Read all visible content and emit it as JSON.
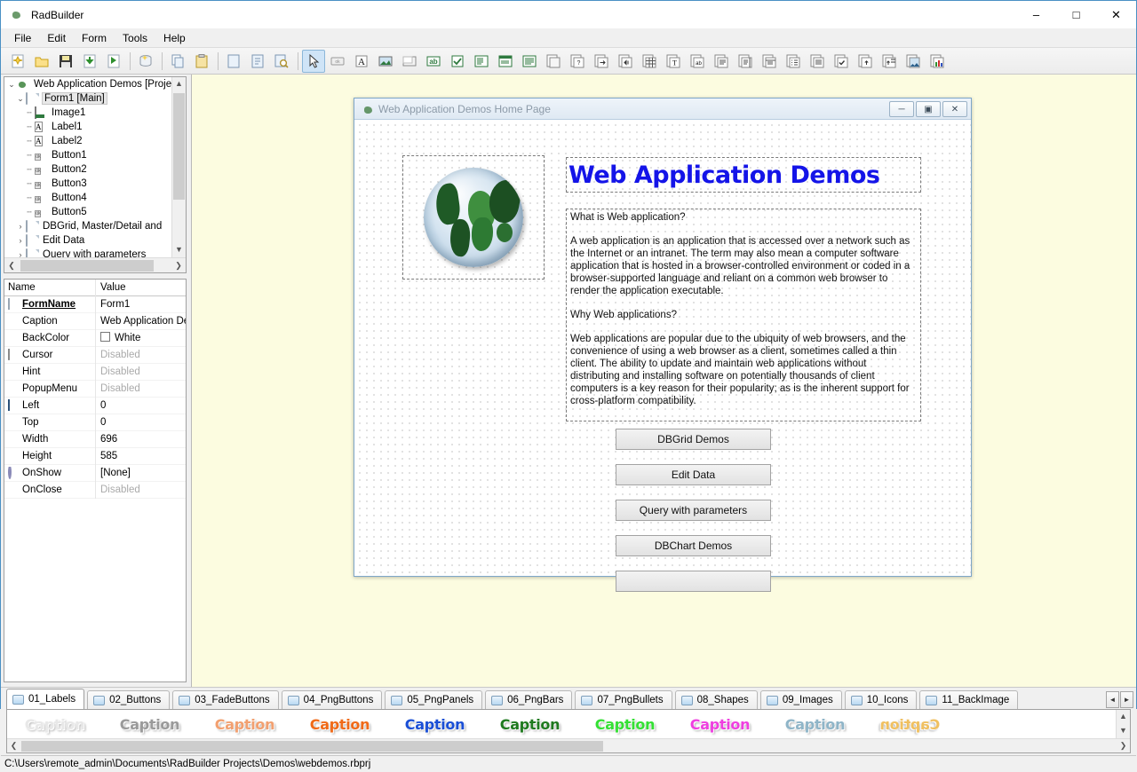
{
  "window": {
    "title": "RadBuilder",
    "app_icon": "globe-icon",
    "controls": {
      "minimize": "–",
      "maximize": "□",
      "close": "✕"
    }
  },
  "menu": {
    "items": [
      "File",
      "Edit",
      "Form",
      "Tools",
      "Help"
    ]
  },
  "toolbar": {
    "groups": [
      {
        "buttons": [
          {
            "name": "new-project-icon",
            "glyph": "✶"
          },
          {
            "name": "open-project-icon",
            "glyph": "📂"
          },
          {
            "name": "save-icon",
            "glyph": "💾"
          },
          {
            "name": "import-icon",
            "glyph": "⬇"
          },
          {
            "name": "run-icon",
            "glyph": "▶"
          }
        ]
      },
      {
        "buttons": [
          {
            "name": "database-icon",
            "glyph": "🗄"
          }
        ]
      },
      {
        "buttons": [
          {
            "name": "copy-icon",
            "glyph": "⧉"
          },
          {
            "name": "paste-icon",
            "glyph": "📋"
          }
        ]
      },
      {
        "buttons": [
          {
            "name": "new-form-icon",
            "glyph": "📄"
          },
          {
            "name": "edit-form-icon",
            "glyph": "📃"
          },
          {
            "name": "preview-icon",
            "glyph": "🔍"
          }
        ]
      },
      {
        "buttons": [
          {
            "name": "select-pointer-icon",
            "glyph": "↖",
            "active": true
          },
          {
            "name": "button-control-icon",
            "glyph": "ok"
          },
          {
            "name": "label-control-icon",
            "glyph": "A"
          },
          {
            "name": "image-control-icon",
            "glyph": "🖼"
          },
          {
            "name": "panel-control-icon",
            "glyph": "▭"
          },
          {
            "name": "edit-control-icon",
            "glyph": "ab"
          },
          {
            "name": "checkbox-control-icon",
            "glyph": "✔"
          },
          {
            "name": "listbox-control-icon",
            "glyph": "☰"
          },
          {
            "name": "combobox-control-icon",
            "glyph": "▤"
          },
          {
            "name": "memo-control-icon",
            "glyph": "▥"
          },
          {
            "name": "db-navigator-icon",
            "glyph": "▢"
          },
          {
            "name": "db-query-icon",
            "glyph": "?"
          },
          {
            "name": "db-goto-icon",
            "glyph": "➡"
          },
          {
            "name": "db-nav-icon",
            "glyph": "◧"
          },
          {
            "name": "dbgrid-icon",
            "glyph": "▦"
          },
          {
            "name": "dbtext-icon",
            "glyph": "T"
          },
          {
            "name": "dbedit-icon",
            "glyph": "ab"
          },
          {
            "name": "dbmemo-icon",
            "glyph": "▤"
          },
          {
            "name": "dblistbox-icon",
            "glyph": "▤"
          },
          {
            "name": "dbcombobox-icon",
            "glyph": "▤"
          },
          {
            "name": "dbradio-icon",
            "glyph": "▤"
          },
          {
            "name": "dblookup-icon",
            "glyph": "▤"
          },
          {
            "name": "dbcheckbox-icon",
            "glyph": "☑"
          },
          {
            "name": "dbupload-icon",
            "glyph": "⬆"
          },
          {
            "name": "dbexport-icon",
            "glyph": "⬆"
          },
          {
            "name": "dbimage-icon",
            "glyph": "🖼"
          },
          {
            "name": "dbchart-icon",
            "glyph": "📊"
          }
        ]
      }
    ]
  },
  "project_tree": {
    "nodes": [
      {
        "label": "Web Application Demos [Proje",
        "icon": "globe-icon",
        "indent": 0,
        "twist": "v",
        "selected": false
      },
      {
        "label": "Form1 [Main]",
        "icon": "form-icon",
        "indent": 1,
        "twist": "v",
        "selected": true
      },
      {
        "label": "Image1",
        "icon": "image-icon",
        "indent": 2,
        "twist": "",
        "selected": false
      },
      {
        "label": "Label1",
        "icon": "label-icon",
        "indent": 2,
        "twist": "",
        "selected": false
      },
      {
        "label": "Label2",
        "icon": "label-icon",
        "indent": 2,
        "twist": "",
        "selected": false
      },
      {
        "label": "Button1",
        "icon": "button-icon",
        "indent": 2,
        "twist": "",
        "selected": false
      },
      {
        "label": "Button2",
        "icon": "button-icon",
        "indent": 2,
        "twist": "",
        "selected": false
      },
      {
        "label": "Button3",
        "icon": "button-icon",
        "indent": 2,
        "twist": "",
        "selected": false
      },
      {
        "label": "Button4",
        "icon": "button-icon",
        "indent": 2,
        "twist": "",
        "selected": false
      },
      {
        "label": "Button5",
        "icon": "button-icon",
        "indent": 2,
        "twist": "",
        "selected": false
      },
      {
        "label": "DBGrid, Master/Detail and",
        "icon": "form-icon",
        "indent": 1,
        "twist": ">",
        "selected": false
      },
      {
        "label": "Edit Data",
        "icon": "form-icon",
        "indent": 1,
        "twist": ">",
        "selected": false
      },
      {
        "label": "Query with parameters",
        "icon": "form-icon",
        "indent": 1,
        "twist": ">",
        "selected": false
      }
    ]
  },
  "property_grid": {
    "headers": {
      "name": "Name",
      "value": "Value"
    },
    "rows": [
      {
        "name": "FormName",
        "value": "Form1",
        "icon": "doc-icon",
        "bold": true,
        "disabled": false
      },
      {
        "name": "Caption",
        "value": "Web Application Dem",
        "icon": "",
        "bold": false,
        "disabled": false
      },
      {
        "name": "BackColor",
        "value": "White",
        "icon": "",
        "bold": false,
        "disabled": false,
        "swatch": "#ffffff"
      },
      {
        "name": "Cursor",
        "value": "Disabled",
        "icon": "mouse-icon",
        "bold": false,
        "disabled": true
      },
      {
        "name": "Hint",
        "value": "Disabled",
        "icon": "",
        "bold": false,
        "disabled": true
      },
      {
        "name": "PopupMenu",
        "value": "Disabled",
        "icon": "",
        "bold": false,
        "disabled": true
      },
      {
        "name": "Left",
        "value": "0",
        "icon": "pos-icon",
        "bold": false,
        "disabled": false
      },
      {
        "name": "Top",
        "value": "0",
        "icon": "",
        "bold": false,
        "disabled": false
      },
      {
        "name": "Width",
        "value": "696",
        "icon": "",
        "bold": false,
        "disabled": false
      },
      {
        "name": "Height",
        "value": "585",
        "icon": "",
        "bold": false,
        "disabled": false
      },
      {
        "name": "OnShow",
        "value": "[None]",
        "icon": "event-icon",
        "bold": false,
        "disabled": false
      },
      {
        "name": "OnClose",
        "value": "Disabled",
        "icon": "",
        "bold": false,
        "disabled": true
      }
    ]
  },
  "form_designer": {
    "window_title": "Web Application Demos Home Page",
    "window_icon": "globe-icon",
    "window_controls": {
      "minimize": "─",
      "maximize": "▣",
      "close": "✕"
    },
    "image": {
      "name": "Image1",
      "alt": "world-globe-image"
    },
    "heading": "Web Application Demos",
    "heading_color": "#1414e8",
    "paragraphs": [
      "What is Web application?",
      "A web application is an application that is accessed over a network such as the Internet or an intranet. The term may also mean a computer software application that is hosted in a browser-controlled environment or coded in a browser-supported language and reliant on a common web browser to render the application executable.",
      "Why Web applications?",
      "Web applications are popular due to the ubiquity of web browsers, and the convenience of using a web browser as a client, sometimes called a thin client. The ability to update and maintain web applications without distributing and installing software on potentially thousands of client computers is a key reason for their popularity; as is the inherent support for cross-platform compatibility."
    ],
    "buttons": [
      "DBGrid Demos",
      "Edit Data",
      "Query with parameters",
      "DBChart Demos",
      ""
    ]
  },
  "palette": {
    "tabs": [
      {
        "label": "01_Labels",
        "active": true
      },
      {
        "label": "02_Buttons",
        "active": false
      },
      {
        "label": "03_FadeButtons",
        "active": false
      },
      {
        "label": "04_PngButtons",
        "active": false
      },
      {
        "label": "05_PngPanels",
        "active": false
      },
      {
        "label": "06_PngBars",
        "active": false
      },
      {
        "label": "07_PngBullets",
        "active": false
      },
      {
        "label": "08_Shapes",
        "active": false
      },
      {
        "label": "09_Images",
        "active": false
      },
      {
        "label": "10_Icons",
        "active": false
      },
      {
        "label": "11_BackImage",
        "active": false
      }
    ],
    "nav": {
      "prev": "◄",
      "next": "►"
    },
    "items": [
      {
        "label": "Caption",
        "color": "#e8e8e8",
        "mirrored": false
      },
      {
        "label": "Caption",
        "color": "#9a9a9a",
        "mirrored": false
      },
      {
        "label": "Caption",
        "color": "#f2a070",
        "mirrored": false
      },
      {
        "label": "Caption",
        "color": "#f06a18",
        "mirrored": false
      },
      {
        "label": "Caption",
        "color": "#1a4fd6",
        "mirrored": false
      },
      {
        "label": "Caption",
        "color": "#1f7a1f",
        "mirrored": false
      },
      {
        "label": "Caption",
        "color": "#34e034",
        "mirrored": false
      },
      {
        "label": "Caption",
        "color": "#ef3fe0",
        "mirrored": false
      },
      {
        "label": "Caption",
        "color": "#8fb5c8",
        "mirrored": false
      },
      {
        "label": "Caption",
        "color": "#f0c060",
        "mirrored": true
      }
    ]
  },
  "statusbar": {
    "path": "C:\\Users\\remote_admin\\Documents\\RadBuilder Projects\\Demos\\webdemos.rbprj"
  }
}
